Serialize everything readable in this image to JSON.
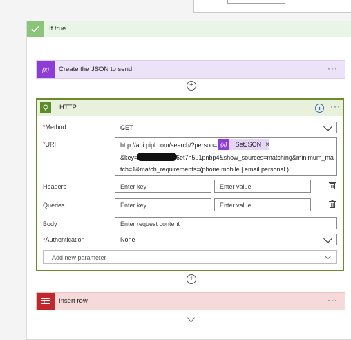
{
  "condition": {
    "title": "If true"
  },
  "compose_action": {
    "title": "Create the JSON to send",
    "menu": "···"
  },
  "http_action": {
    "title": "HTTP",
    "menu": "···",
    "method": {
      "label": "Method",
      "value": "GET"
    },
    "uri": {
      "label": "URI",
      "line1_prefix": "http://api.pipl.com/search/?person=",
      "token_label": "SetJSON",
      "token_remove": "×",
      "line2_prefix": "&key=",
      "line2_suffix": "6et7h5u1pnbp4&show_sources=matching&minimum_ma",
      "line3": "tch=1&match_requirements=(phone.mobile | email.personal )"
    },
    "headers": {
      "label": "Headers",
      "key_placeholder": "Enter key",
      "value_placeholder": "Enter value"
    },
    "queries": {
      "label": "Queries",
      "key_placeholder": "Enter key",
      "value_placeholder": "Enter value"
    },
    "body": {
      "label": "Body",
      "placeholder": "Enter request content"
    },
    "authentication": {
      "label": "Authentication",
      "value": "None"
    },
    "add_parameter": {
      "label": "Add new parameter"
    }
  },
  "insert_action": {
    "title": "Insert row",
    "menu": "···"
  },
  "required_marker": "*",
  "icons": {
    "check": "check-icon",
    "variable": "{x}",
    "globe": "globe-icon",
    "info": "i",
    "plus": "+",
    "table": "table-icon"
  },
  "colors": {
    "condition_accent": "#8bc47a",
    "compose_accent": "#8d3dd6",
    "http_accent": "#6b8c2b",
    "insert_accent": "#c0282e",
    "required": "#cc0000"
  }
}
